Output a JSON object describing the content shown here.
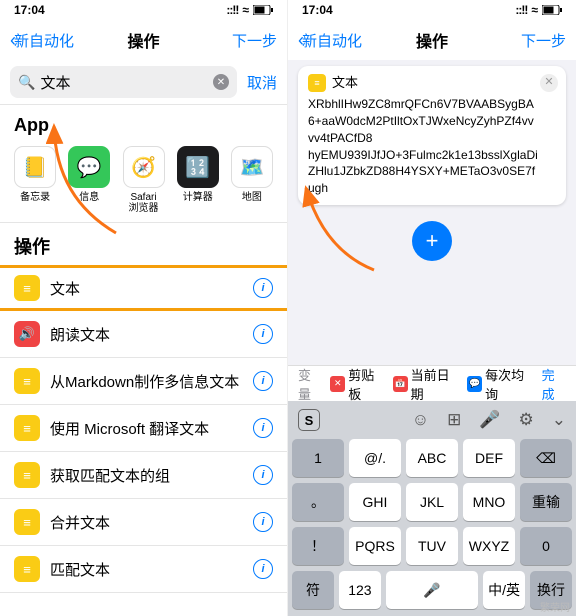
{
  "status": {
    "time": "17:04",
    "signal": "::!!",
    "wifi": "≈"
  },
  "nav": {
    "back": "新自动化",
    "title": "操作",
    "next": "下一步"
  },
  "search": {
    "value": "文本",
    "cancel": "取消"
  },
  "sections": {
    "apps": "App",
    "actions": "操作"
  },
  "apps": [
    {
      "label": "备忘录",
      "bg": "#fff",
      "emoji": "📒",
      "border": true
    },
    {
      "label": "信息",
      "bg": "#34c759",
      "emoji": "💬"
    },
    {
      "label": "Safari\n浏览器",
      "bg": "#fff",
      "emoji": "🧭",
      "border": true
    },
    {
      "label": "计算器",
      "bg": "#1c1c1e",
      "emoji": "🔢"
    },
    {
      "label": "地图",
      "bg": "#fff",
      "emoji": "🗺️",
      "border": true
    }
  ],
  "actions": [
    {
      "label": "文本",
      "color": "yellow",
      "glyph": "≡",
      "hl": true
    },
    {
      "label": "朗读文本",
      "color": "red",
      "glyph": "🔊"
    },
    {
      "label": "从Markdown制作多信息文本",
      "color": "yellow",
      "glyph": "≡"
    },
    {
      "label": "使用 Microsoft 翻译文本",
      "color": "yellow",
      "glyph": "≡"
    },
    {
      "label": "获取匹配文本的组",
      "color": "yellow",
      "glyph": "≡"
    },
    {
      "label": "合并文本",
      "color": "yellow",
      "glyph": "≡"
    },
    {
      "label": "匹配文本",
      "color": "yellow",
      "glyph": "≡"
    }
  ],
  "card": {
    "title": "文本",
    "body": "XRbhlIHw9ZC8mrQFCn6V7BVAABSygBA6+aaW0dcM2PtIltOxTJWxeNcyZyhPZf4vvvv4tPACfD8\nhyEMU939IJfJO+3Fulmc2k1e13bsslXglaDiZHlu1JZbkZD88H4YSXY+METaO3v0SE7fugh"
  },
  "bottombar": {
    "var": "变量",
    "clip": "剪贴板",
    "date": "当前日期",
    "ask": "每次均询",
    "done": "完成"
  },
  "keyboard": {
    "rows": [
      [
        "1",
        "@/.",
        "ABC",
        "DEF",
        "⌫"
      ],
      [
        "。",
        "GHI",
        "JKL",
        "MNO",
        "重输"
      ],
      [
        "！",
        "PQRS",
        "TUV",
        "WXYZ",
        "0"
      ],
      [
        "符",
        "123",
        "🎤",
        "中/英",
        "换行"
      ]
    ]
  },
  "watermark": "繁荣网"
}
